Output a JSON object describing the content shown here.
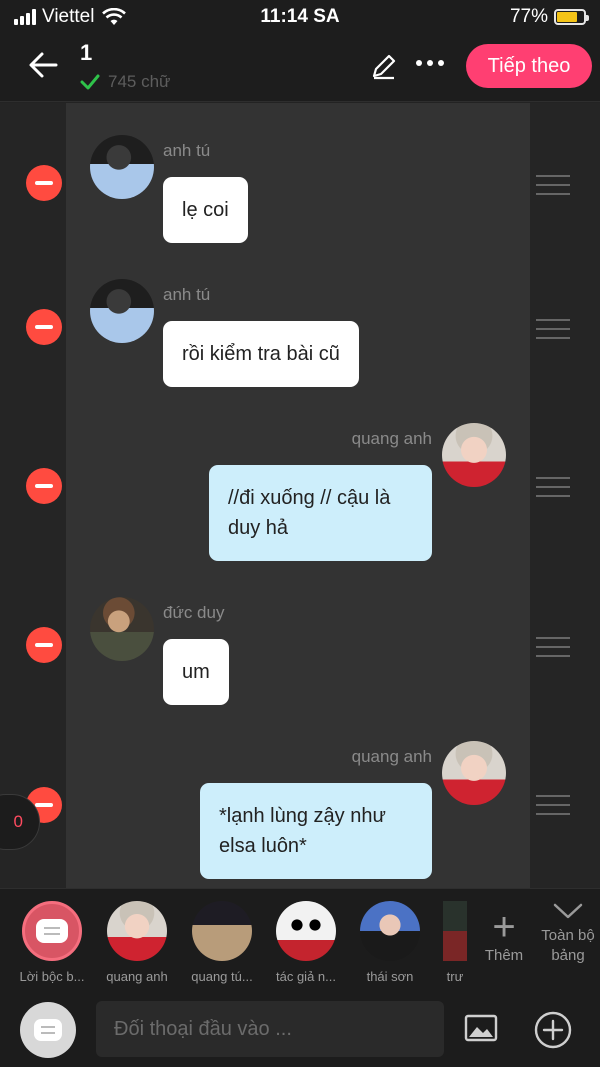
{
  "status_bar": {
    "carrier": "Viettel",
    "time": "11:14 SA",
    "battery_percent": "77%",
    "battery_level": 0.77
  },
  "header": {
    "title": "1",
    "word_count": "745 chữ",
    "next_label": "Tiếp theo",
    "accent_color": "#ff3f72"
  },
  "messages": [
    {
      "speaker": "anh tú",
      "text": "lẹ coi",
      "side": "left"
    },
    {
      "speaker": "anh tú",
      "text": "rồi kiểm tra bài cũ",
      "side": "left"
    },
    {
      "speaker": "quang anh",
      "text": "//đi xuống // cậu là duy hả",
      "side": "right"
    },
    {
      "speaker": "đức duy",
      "text": "um",
      "side": "left"
    },
    {
      "speaker": "quang anh",
      "text": "*lạnh lùng zậy như elsa luôn*",
      "side": "right"
    }
  ],
  "unread_count": "0",
  "characters": [
    {
      "label": "Lời bộc b..."
    },
    {
      "label": "quang anh"
    },
    {
      "label": "quang tú..."
    },
    {
      "label": "tác giả n..."
    },
    {
      "label": "thái sơn"
    },
    {
      "label": "trư"
    }
  ],
  "char_actions": {
    "add_label": "Thêm",
    "fullboard_label": "Toàn bộ bảng"
  },
  "input_bar": {
    "placeholder": "Đối thoại đầu vào ..."
  }
}
